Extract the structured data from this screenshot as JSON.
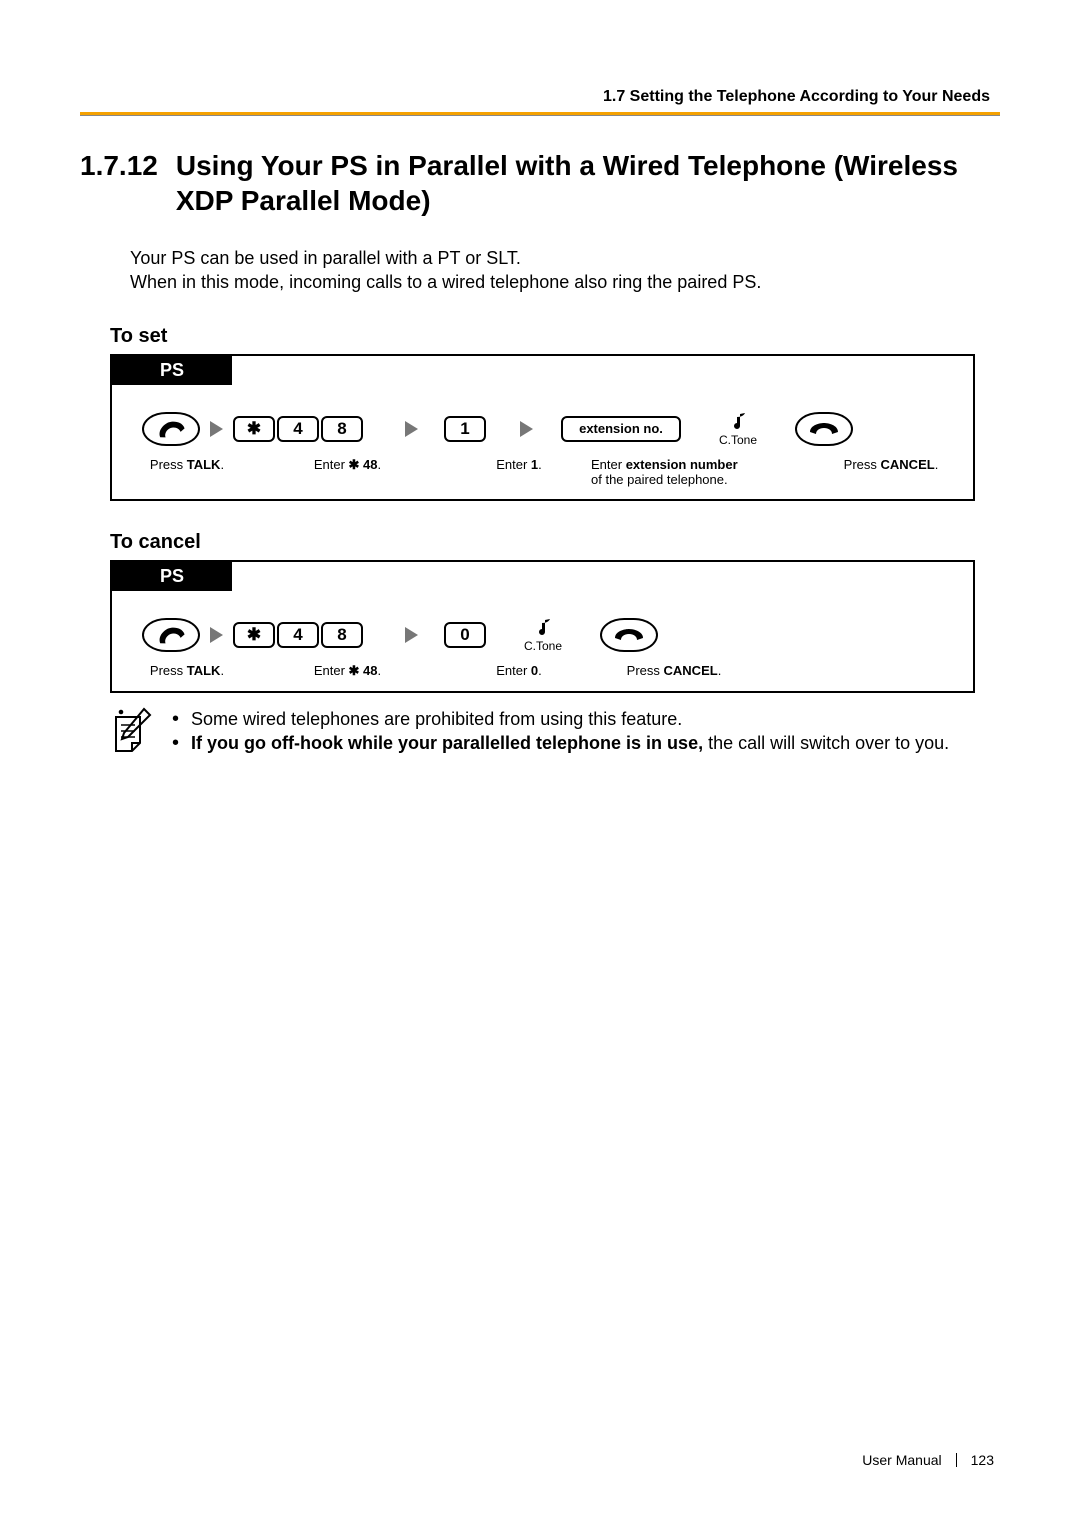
{
  "running_head": "1.7 Setting the Telephone According to Your Needs",
  "section": {
    "number": "1.7.12",
    "title": "Using Your PS in Parallel with a Wired Telephone (Wireless XDP Parallel Mode)"
  },
  "intro_line1": "Your PS can be used in parallel with a PT or SLT.",
  "intro_line2": "When in this mode, incoming calls to a wired telephone also ring the paired PS.",
  "set": {
    "heading": "To set",
    "tab": "PS",
    "keys": {
      "star": "✱",
      "d4": "4",
      "d8": "8",
      "d1": "1",
      "ext": "extension no."
    },
    "ctone": "C.Tone",
    "captions": {
      "talk_a": "Press ",
      "talk_b": "TALK",
      "talk_c": ".",
      "e48_a": "Enter ",
      "e48_b": "✱",
      "e48_c": " 48",
      "e48_d": ".",
      "e1_a": "Enter ",
      "e1_b": "1",
      "e1_c": ".",
      "ext_a": "Enter ",
      "ext_b": "extension number",
      "ext_line2": "of the paired telephone.",
      "cancel_a": "Press ",
      "cancel_b": "CANCEL",
      "cancel_c": "."
    }
  },
  "cancel": {
    "heading": "To cancel",
    "tab": "PS",
    "keys": {
      "star": "✱",
      "d4": "4",
      "d8": "8",
      "d0": "0"
    },
    "ctone": "C.Tone",
    "captions": {
      "talk_a": "Press ",
      "talk_b": "TALK",
      "talk_c": ".",
      "e48_a": "Enter ",
      "e48_b": "✱",
      "e48_c": " 48",
      "e48_d": ".",
      "e0_a": "Enter ",
      "e0_b": "0",
      "e0_c": ".",
      "cancel_a": "Press ",
      "cancel_b": "CANCEL",
      "cancel_c": "."
    }
  },
  "notes": {
    "bullet1": "Some wired telephones are prohibited from using this feature.",
    "bullet2_b": "If you go off-hook while your parallelled telephone is in use,",
    "bullet2_rest": " the call will switch over to you."
  },
  "footer": {
    "label": "User Manual",
    "page": "123"
  }
}
